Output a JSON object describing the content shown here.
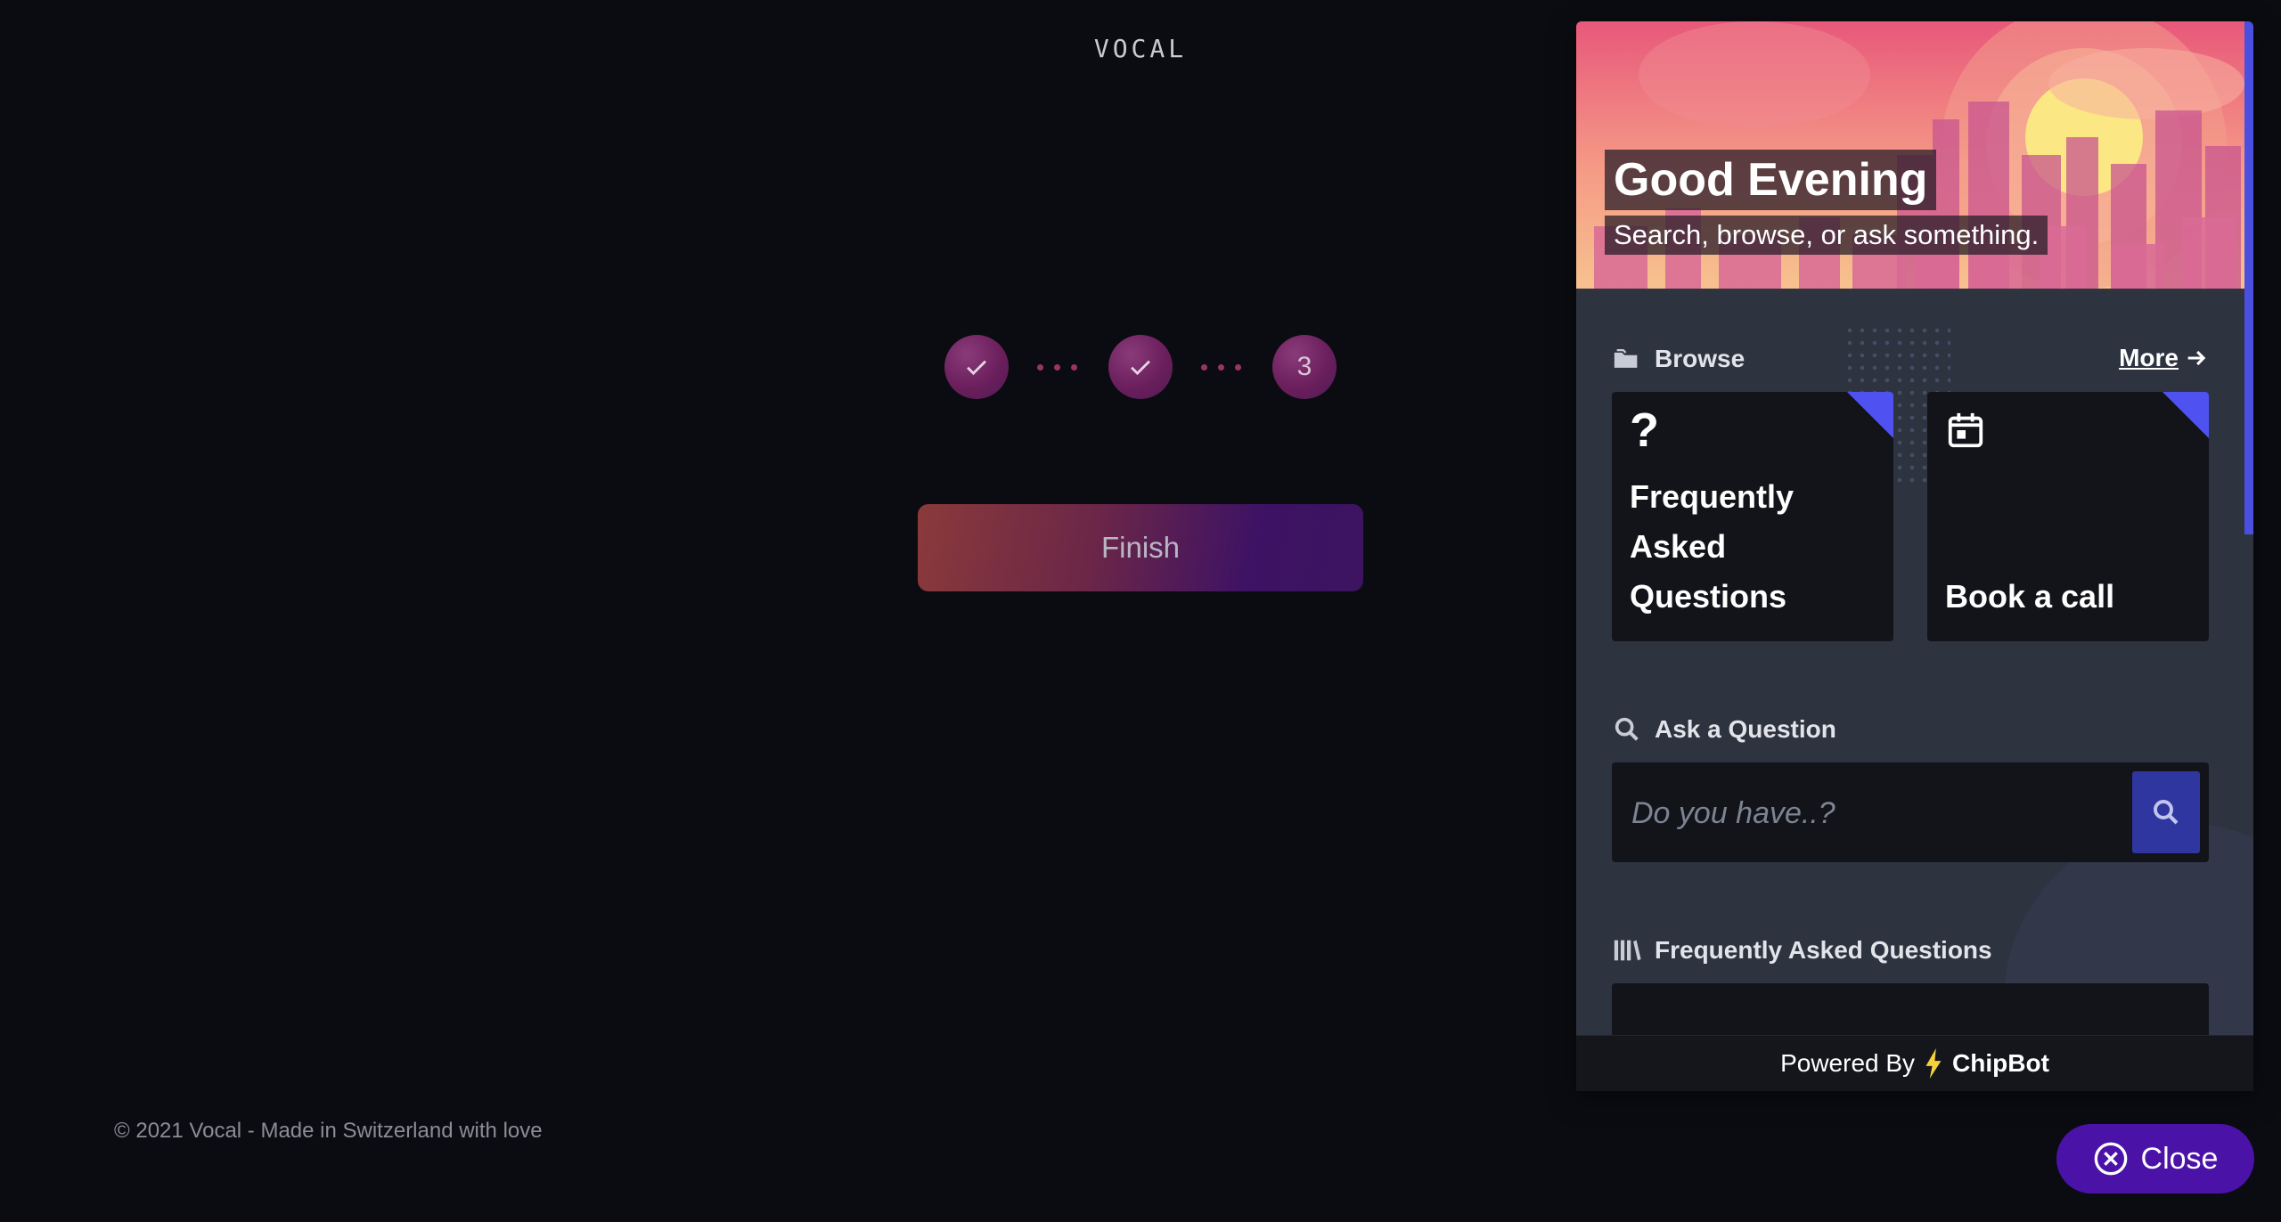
{
  "app": {
    "logo": "VOCAL",
    "steps": [
      {
        "state": "done",
        "icon": "check-icon"
      },
      {
        "state": "done",
        "icon": "check-icon"
      },
      {
        "state": "current",
        "label": "3"
      }
    ],
    "finish_label": "Finish",
    "copyright": "© 2021 Vocal - Made in Switzerland with love"
  },
  "widget": {
    "greeting": "Good Evening",
    "subtitle": "Search, browse, or ask something.",
    "browse": {
      "title": "Browse",
      "more_label": "More",
      "cards": [
        {
          "label": "Frequently Asked Questions",
          "icon": "question-icon"
        },
        {
          "label": "Book a call",
          "icon": "calendar-icon"
        }
      ]
    },
    "ask": {
      "title": "Ask a Question",
      "placeholder": "Do you have..?"
    },
    "faq": {
      "title": "Frequently Asked Questions"
    },
    "powered_by": "Powered By",
    "brand": "ChipBot",
    "close_label": "Close"
  },
  "colors": {
    "background": "#0b0c11",
    "panel": "#2d3440",
    "accent": "#4f52f0",
    "close_button": "#4b12a8"
  }
}
